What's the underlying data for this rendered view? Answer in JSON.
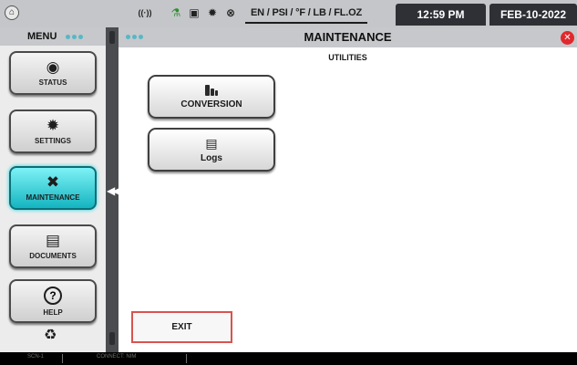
{
  "statusbar": {
    "home_icon": "home-circle-icon",
    "icons": [
      "wireless-icon",
      "microscope-icon",
      "clipboard-icon",
      "gear-icon",
      "network-icon"
    ],
    "wireless_glyph": "((·))",
    "units": "EN / PSI / °F / LB / FL.OZ",
    "time": "12:59 PM",
    "date": "FEB-10-2022"
  },
  "sidebar": {
    "menu_label": "MENU",
    "items": [
      {
        "label": "STATUS",
        "icon": "gauge-icon"
      },
      {
        "label": "SETTINGS",
        "icon": "gear-icon"
      },
      {
        "label": "MAINTENANCE",
        "icon": "wrench-icon",
        "active": true
      },
      {
        "label": "DOCUMENTS",
        "icon": "document-icon"
      },
      {
        "label": "HELP",
        "icon": "help-icon"
      }
    ],
    "bottom_icon": "recycle-icon"
  },
  "main": {
    "title": "MAINTENANCE",
    "section": "UTILITIES",
    "buttons": [
      {
        "label": "CONVERSION",
        "icon": "weights-icon"
      },
      {
        "label": "Logs",
        "icon": "log-file-icon"
      }
    ],
    "exit_label": "EXIT"
  },
  "bottombar": {
    "left_text": "SCN-1",
    "mid_text": "CONNECT: NIM"
  },
  "colors": {
    "active": "#19c2cc",
    "close": "#e1282d",
    "exit_border": "#d9534f",
    "dark_tab": "#2e3036"
  }
}
